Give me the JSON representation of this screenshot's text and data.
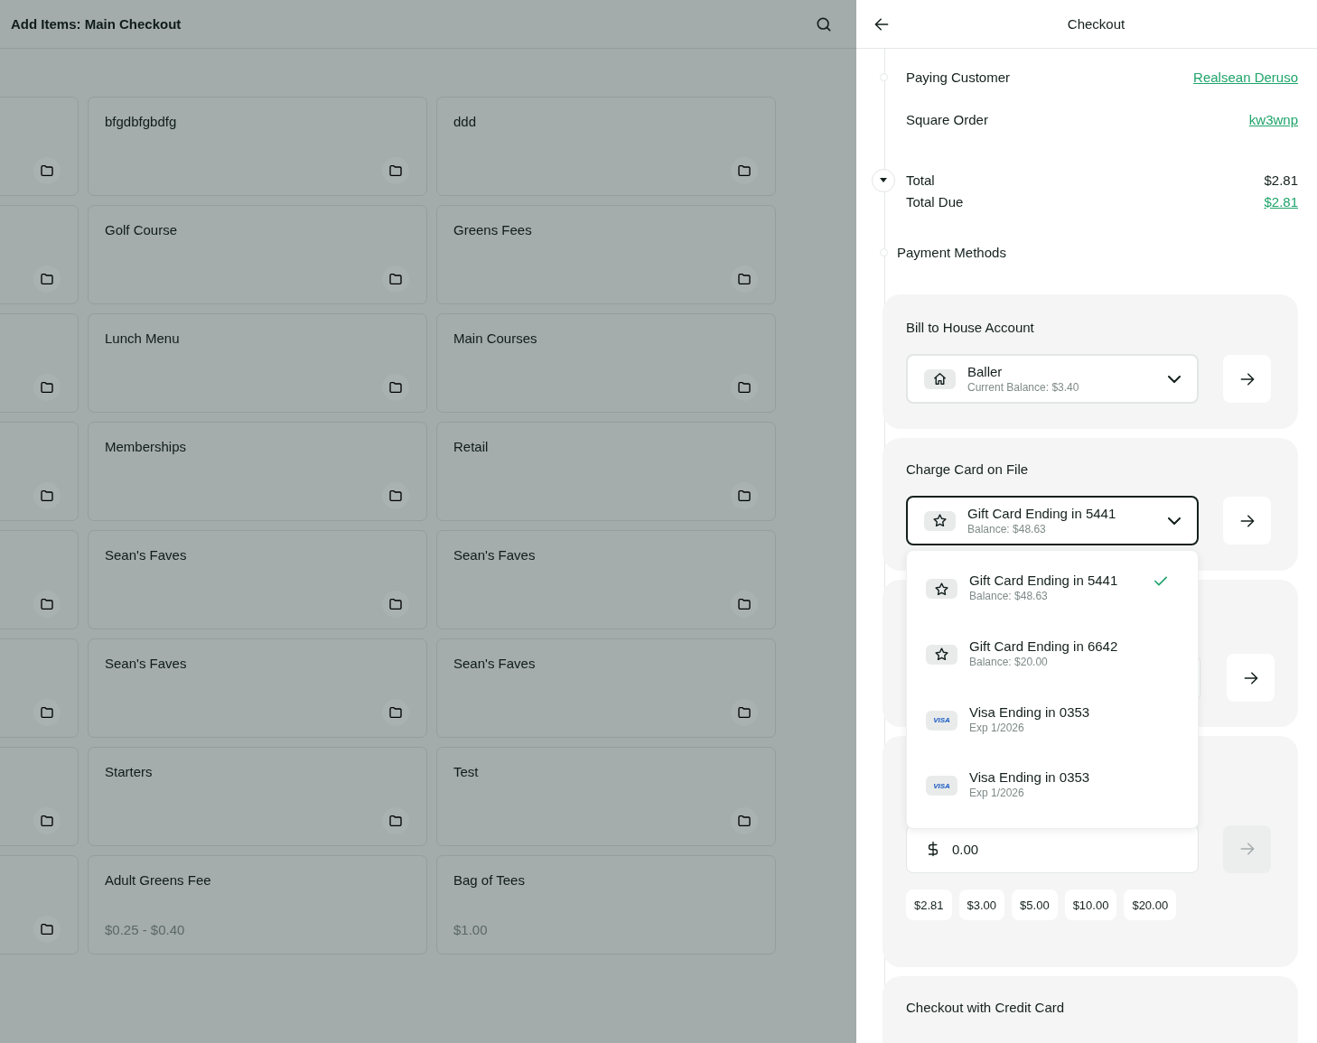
{
  "main": {
    "title": "Add Items: Main Checkout",
    "tiles": [
      {
        "kind": "folder"
      },
      {
        "kind": "folder",
        "label": "bfgdbfgbdfg"
      },
      {
        "kind": "folder",
        "label": "ddd"
      },
      {
        "kind": "folder"
      },
      {
        "kind": "folder",
        "label": "Golf Course"
      },
      {
        "kind": "folder",
        "label": "Greens Fees"
      },
      {
        "kind": "folder"
      },
      {
        "kind": "folder",
        "label": "Lunch Menu"
      },
      {
        "kind": "folder",
        "label": "Main Courses"
      },
      {
        "kind": "folder"
      },
      {
        "kind": "folder",
        "label": "Memberships"
      },
      {
        "kind": "folder",
        "label": "Retail"
      },
      {
        "kind": "folder"
      },
      {
        "kind": "folder",
        "label": "Sean's Faves"
      },
      {
        "kind": "folder",
        "label": "Sean's Faves"
      },
      {
        "kind": "folder"
      },
      {
        "kind": "folder",
        "label": "Sean's Faves"
      },
      {
        "kind": "folder",
        "label": "Sean's Faves"
      },
      {
        "kind": "folder"
      },
      {
        "kind": "folder",
        "label": "Starters"
      },
      {
        "kind": "folder",
        "label": "Test"
      },
      {
        "kind": "folder"
      },
      {
        "kind": "item",
        "label": "Adult Greens Fee",
        "price": "$0.25 - $0.40"
      },
      {
        "kind": "item",
        "label": "Bag of Tees",
        "price": "$1.00"
      }
    ]
  },
  "checkout": {
    "title": "Checkout",
    "details": [
      {
        "label": "Paying Customer",
        "value": "Realsean Deruso",
        "link": true
      },
      {
        "label": "Square Order",
        "value": "kw3wnp",
        "link": true
      }
    ],
    "totals": [
      {
        "label": "Total",
        "value": "$2.81",
        "link": false
      },
      {
        "label": "Total Due",
        "value": "$2.81",
        "link": true
      }
    ],
    "payment_methods_label": "Payment Methods",
    "house_account": {
      "title": "Bill to House Account",
      "selection": {
        "kind": "house",
        "name": "Baller",
        "sub": "Current Balance: $3.40"
      }
    },
    "card_on_file": {
      "title": "Charge Card on File",
      "open": true,
      "selection": {
        "kind": "gift",
        "name": "Gift Card Ending in 5441",
        "sub": "Balance: $48.63"
      },
      "options": [
        {
          "kind": "gift",
          "name": "Gift Card Ending in 5441",
          "sub": "Balance: $48.63",
          "selected": true
        },
        {
          "kind": "gift",
          "name": "Gift Card Ending in 6642",
          "sub": "Balance: $20.00",
          "selected": false
        },
        {
          "kind": "visa",
          "brand": "VISA",
          "name": "Visa Ending in 0353",
          "sub": "Exp 1/2026",
          "selected": false
        },
        {
          "kind": "visa",
          "brand": "VISA",
          "name": "Visa Ending in 0353",
          "sub": "Exp 1/2026",
          "selected": false
        }
      ]
    },
    "amount": {
      "value": "0.00",
      "submit_disabled": true,
      "quick_amounts": [
        "$2.81",
        "$3.00",
        "$5.00",
        "$10.00",
        "$20.00"
      ]
    },
    "credit_card": {
      "title": "Checkout with Credit Card"
    }
  }
}
